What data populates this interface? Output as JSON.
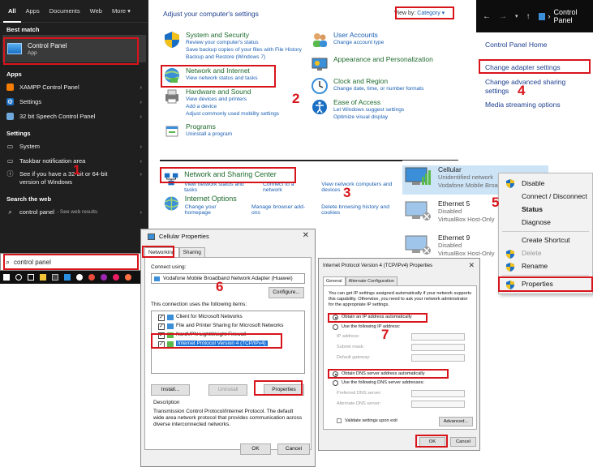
{
  "start_menu": {
    "tabs": [
      "All",
      "Apps",
      "Documents",
      "Web",
      "More ▾"
    ],
    "best_match_heading": "Best match",
    "best_match": {
      "title": "Control Panel",
      "subtitle": "App"
    },
    "apps_heading": "Apps",
    "apps": [
      {
        "label": "XAMPP Control Panel",
        "icon": "xampp-icon"
      },
      {
        "label": "Settings",
        "icon": "gear-icon"
      },
      {
        "label": "32 bit Speech Control Panel",
        "icon": "speech-icon"
      }
    ],
    "settings_heading": "Settings",
    "settings": [
      {
        "label": "System"
      },
      {
        "label": "Taskbar notification area"
      },
      {
        "label": "See if you have a 32-bit or 64-bit version of Windows"
      }
    ],
    "web_heading": "Search the web",
    "web_item": {
      "label": "control panel",
      "sub": "- See web results"
    },
    "search_value": "control panel",
    "step": "1"
  },
  "control_panel": {
    "heading": "Adjust your computer's settings",
    "view_by_label": "View by:",
    "view_by_value": "Category ▾",
    "step": "2",
    "categories": [
      {
        "title": "System and Security",
        "links": [
          "Review your computer's status",
          "Save backup copies of your files with File History",
          "Backup and Restore (Windows 7)"
        ]
      },
      {
        "title": "Network and Internet",
        "links": [
          "View network status and tasks"
        ]
      },
      {
        "title": "Hardware and Sound",
        "links": [
          "View devices and printers",
          "Add a device",
          "Adjust commonly used mobility settings"
        ]
      },
      {
        "title": "Programs",
        "links": [
          "Uninstall a program"
        ]
      },
      {
        "title": "User Accounts",
        "links": [
          "Change account type"
        ]
      },
      {
        "title": "Appearance and Personalization",
        "links": []
      },
      {
        "title": "Clock and Region",
        "links": [
          "Change date, time, or number formats"
        ]
      },
      {
        "title": "Ease of Access",
        "links": [
          "Let Windows suggest settings",
          "Optimize visual display"
        ]
      }
    ]
  },
  "network_internet": {
    "step": "3",
    "sharing_center": {
      "title": "Network and Sharing Center",
      "links": [
        "View network status and tasks",
        "Connect to a network",
        "View network computers and devices"
      ]
    },
    "internet_options": {
      "title": "Internet Options",
      "links": [
        "Change your homepage",
        "Manage browser add-ons",
        "Delete browsing history and cookies"
      ]
    }
  },
  "network_connections": {
    "address": "Control Panel",
    "step": "4",
    "links": [
      "Control Panel Home",
      "Change adapter settings",
      "Change advanced sharing settings",
      "Media streaming options"
    ]
  },
  "adapters": {
    "step": "5",
    "items": [
      {
        "name": "Cellular",
        "status": "Unidentified network",
        "device": "Vodafone Mobile Broadband"
      },
      {
        "name": "Ethernet 5",
        "status": "Disabled",
        "device": "VirtualBox Host-Only"
      },
      {
        "name": "Ethernet 9",
        "status": "Disabled",
        "device": "VirtualBox Host-Only"
      }
    ]
  },
  "context_menu": {
    "items": [
      "Disable",
      "Connect / Disconnect",
      "Status",
      "Diagnose",
      "Create Shortcut",
      "Delete",
      "Rename",
      "Properties"
    ]
  },
  "cellular_properties": {
    "title": "Cellular Properties",
    "step": "6",
    "tabs": [
      "Networking",
      "Sharing"
    ],
    "connect_using_label": "Connect using:",
    "adapter": "Vodafone Mobile Broadband Network Adapter (Huawei)",
    "configure_label": "Configure...",
    "items_label": "This connection uses the following items:",
    "items": [
      {
        "label": "Client for Microsoft Networks",
        "checked": true
      },
      {
        "label": "File and Printer Sharing for Microsoft Networks",
        "checked": true
      },
      {
        "label": "NordVPN LightWeight Firewall",
        "checked": true
      },
      {
        "label": "Internet Protocol Version 4 (TCP/IPv4)",
        "checked": true
      }
    ],
    "install_label": "Install...",
    "uninstall_label": "Uninstall",
    "properties_label": "Properties",
    "description_label": "Description",
    "description": "Transmission Control Protocol/Internet Protocol. The default wide area network protocol that provides communication across diverse interconnected networks.",
    "ok_label": "OK",
    "cancel_label": "Cancel"
  },
  "ipv4_properties": {
    "title": "Internet Protocol Version 4 (TCP/IPv4) Properties",
    "step": "7",
    "tabs": [
      "General",
      "Alternate Configuration"
    ],
    "intro": "You can get IP settings assigned automatically if your network supports this capability. Otherwise, you need to ask your network administrator for the appropriate IP settings.",
    "obtain_ip": "Obtain an IP address automatically",
    "use_ip": "Use the following IP address:",
    "ip_fields": [
      "IP address:",
      "Subnet mask:",
      "Default gateway:"
    ],
    "obtain_dns": "Obtain DNS server address automatically",
    "use_dns": "Use the following DNS server addresses:",
    "dns_fields": [
      "Preferred DNS server:",
      "Alternate DNS server:"
    ],
    "validate_label": "Validate settings upon exit",
    "advanced_label": "Advanced...",
    "ok_label": "OK",
    "cancel_label": "Cancel"
  },
  "colors": {
    "highlight": "#d8141b",
    "link": "#1a5fb4",
    "category": "#1d6a2c"
  }
}
